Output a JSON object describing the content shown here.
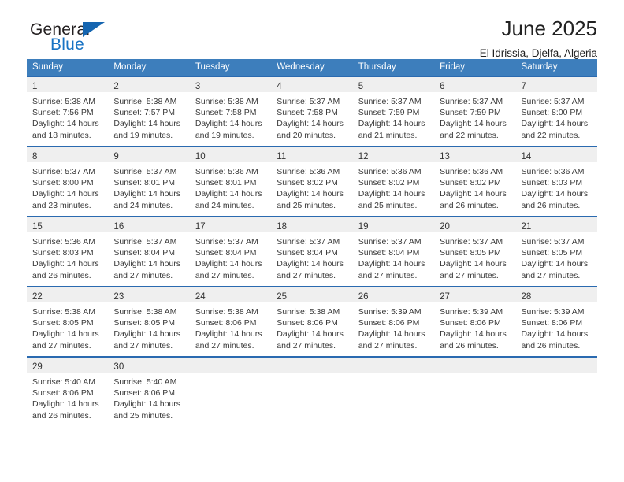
{
  "brand": {
    "name_top": "General",
    "name_bottom": "Blue",
    "triangle_color": "#1565b0",
    "blue_color": "#1873c4"
  },
  "header": {
    "title": "June 2025",
    "subtitle": "El Idrissia, Djelfa, Algeria"
  },
  "theme": {
    "header_bg": "#3d7ebc",
    "cell_border_top": "#2a6ab0",
    "daynum_bg": "#efefef"
  },
  "calendar": {
    "weekday_headers": [
      "Sunday",
      "Monday",
      "Tuesday",
      "Wednesday",
      "Thursday",
      "Friday",
      "Saturday"
    ],
    "labels": {
      "sunrise_prefix": "Sunrise:",
      "sunset_prefix": "Sunset:",
      "daylight_prefix": "Daylight:"
    },
    "weeks": [
      [
        {
          "day": "1",
          "sunrise": "Sunrise: 5:38 AM",
          "sunset": "Sunset: 7:56 PM",
          "daylight": "Daylight: 14 hours and 18 minutes."
        },
        {
          "day": "2",
          "sunrise": "Sunrise: 5:38 AM",
          "sunset": "Sunset: 7:57 PM",
          "daylight": "Daylight: 14 hours and 19 minutes."
        },
        {
          "day": "3",
          "sunrise": "Sunrise: 5:38 AM",
          "sunset": "Sunset: 7:58 PM",
          "daylight": "Daylight: 14 hours and 19 minutes."
        },
        {
          "day": "4",
          "sunrise": "Sunrise: 5:37 AM",
          "sunset": "Sunset: 7:58 PM",
          "daylight": "Daylight: 14 hours and 20 minutes."
        },
        {
          "day": "5",
          "sunrise": "Sunrise: 5:37 AM",
          "sunset": "Sunset: 7:59 PM",
          "daylight": "Daylight: 14 hours and 21 minutes."
        },
        {
          "day": "6",
          "sunrise": "Sunrise: 5:37 AM",
          "sunset": "Sunset: 7:59 PM",
          "daylight": "Daylight: 14 hours and 22 minutes."
        },
        {
          "day": "7",
          "sunrise": "Sunrise: 5:37 AM",
          "sunset": "Sunset: 8:00 PM",
          "daylight": "Daylight: 14 hours and 22 minutes."
        }
      ],
      [
        {
          "day": "8",
          "sunrise": "Sunrise: 5:37 AM",
          "sunset": "Sunset: 8:00 PM",
          "daylight": "Daylight: 14 hours and 23 minutes."
        },
        {
          "day": "9",
          "sunrise": "Sunrise: 5:37 AM",
          "sunset": "Sunset: 8:01 PM",
          "daylight": "Daylight: 14 hours and 24 minutes."
        },
        {
          "day": "10",
          "sunrise": "Sunrise: 5:36 AM",
          "sunset": "Sunset: 8:01 PM",
          "daylight": "Daylight: 14 hours and 24 minutes."
        },
        {
          "day": "11",
          "sunrise": "Sunrise: 5:36 AM",
          "sunset": "Sunset: 8:02 PM",
          "daylight": "Daylight: 14 hours and 25 minutes."
        },
        {
          "day": "12",
          "sunrise": "Sunrise: 5:36 AM",
          "sunset": "Sunset: 8:02 PM",
          "daylight": "Daylight: 14 hours and 25 minutes."
        },
        {
          "day": "13",
          "sunrise": "Sunrise: 5:36 AM",
          "sunset": "Sunset: 8:02 PM",
          "daylight": "Daylight: 14 hours and 26 minutes."
        },
        {
          "day": "14",
          "sunrise": "Sunrise: 5:36 AM",
          "sunset": "Sunset: 8:03 PM",
          "daylight": "Daylight: 14 hours and 26 minutes."
        }
      ],
      [
        {
          "day": "15",
          "sunrise": "Sunrise: 5:36 AM",
          "sunset": "Sunset: 8:03 PM",
          "daylight": "Daylight: 14 hours and 26 minutes."
        },
        {
          "day": "16",
          "sunrise": "Sunrise: 5:37 AM",
          "sunset": "Sunset: 8:04 PM",
          "daylight": "Daylight: 14 hours and 27 minutes."
        },
        {
          "day": "17",
          "sunrise": "Sunrise: 5:37 AM",
          "sunset": "Sunset: 8:04 PM",
          "daylight": "Daylight: 14 hours and 27 minutes."
        },
        {
          "day": "18",
          "sunrise": "Sunrise: 5:37 AM",
          "sunset": "Sunset: 8:04 PM",
          "daylight": "Daylight: 14 hours and 27 minutes."
        },
        {
          "day": "19",
          "sunrise": "Sunrise: 5:37 AM",
          "sunset": "Sunset: 8:04 PM",
          "daylight": "Daylight: 14 hours and 27 minutes."
        },
        {
          "day": "20",
          "sunrise": "Sunrise: 5:37 AM",
          "sunset": "Sunset: 8:05 PM",
          "daylight": "Daylight: 14 hours and 27 minutes."
        },
        {
          "day": "21",
          "sunrise": "Sunrise: 5:37 AM",
          "sunset": "Sunset: 8:05 PM",
          "daylight": "Daylight: 14 hours and 27 minutes."
        }
      ],
      [
        {
          "day": "22",
          "sunrise": "Sunrise: 5:38 AM",
          "sunset": "Sunset: 8:05 PM",
          "daylight": "Daylight: 14 hours and 27 minutes."
        },
        {
          "day": "23",
          "sunrise": "Sunrise: 5:38 AM",
          "sunset": "Sunset: 8:05 PM",
          "daylight": "Daylight: 14 hours and 27 minutes."
        },
        {
          "day": "24",
          "sunrise": "Sunrise: 5:38 AM",
          "sunset": "Sunset: 8:06 PM",
          "daylight": "Daylight: 14 hours and 27 minutes."
        },
        {
          "day": "25",
          "sunrise": "Sunrise: 5:38 AM",
          "sunset": "Sunset: 8:06 PM",
          "daylight": "Daylight: 14 hours and 27 minutes."
        },
        {
          "day": "26",
          "sunrise": "Sunrise: 5:39 AM",
          "sunset": "Sunset: 8:06 PM",
          "daylight": "Daylight: 14 hours and 27 minutes."
        },
        {
          "day": "27",
          "sunrise": "Sunrise: 5:39 AM",
          "sunset": "Sunset: 8:06 PM",
          "daylight": "Daylight: 14 hours and 26 minutes."
        },
        {
          "day": "28",
          "sunrise": "Sunrise: 5:39 AM",
          "sunset": "Sunset: 8:06 PM",
          "daylight": "Daylight: 14 hours and 26 minutes."
        }
      ],
      [
        {
          "day": "29",
          "sunrise": "Sunrise: 5:40 AM",
          "sunset": "Sunset: 8:06 PM",
          "daylight": "Daylight: 14 hours and 26 minutes."
        },
        {
          "day": "30",
          "sunrise": "Sunrise: 5:40 AM",
          "sunset": "Sunset: 8:06 PM",
          "daylight": "Daylight: 14 hours and 25 minutes."
        },
        {
          "day": "",
          "sunrise": "",
          "sunset": "",
          "daylight": ""
        },
        {
          "day": "",
          "sunrise": "",
          "sunset": "",
          "daylight": ""
        },
        {
          "day": "",
          "sunrise": "",
          "sunset": "",
          "daylight": ""
        },
        {
          "day": "",
          "sunrise": "",
          "sunset": "",
          "daylight": ""
        },
        {
          "day": "",
          "sunrise": "",
          "sunset": "",
          "daylight": ""
        }
      ]
    ]
  }
}
